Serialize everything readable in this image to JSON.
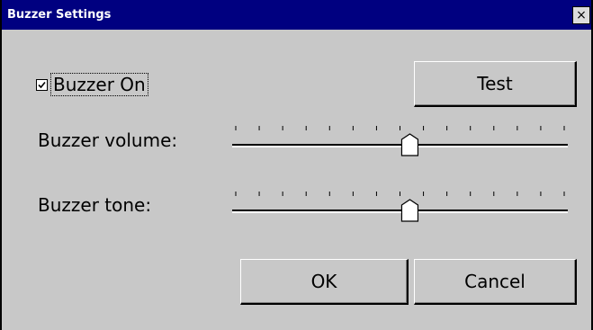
{
  "window": {
    "title": "Buzzer Settings",
    "close_label": "×"
  },
  "buzzer_on": {
    "label": "Buzzer On",
    "checked": true
  },
  "buttons": {
    "test": "Test",
    "ok": "OK",
    "cancel": "Cancel"
  },
  "volume": {
    "label": "Buzzer volume:",
    "value_fraction": 0.53,
    "tick_count": 15
  },
  "tone": {
    "label": "Buzzer tone:",
    "value_fraction": 0.53,
    "tick_count": 15
  }
}
